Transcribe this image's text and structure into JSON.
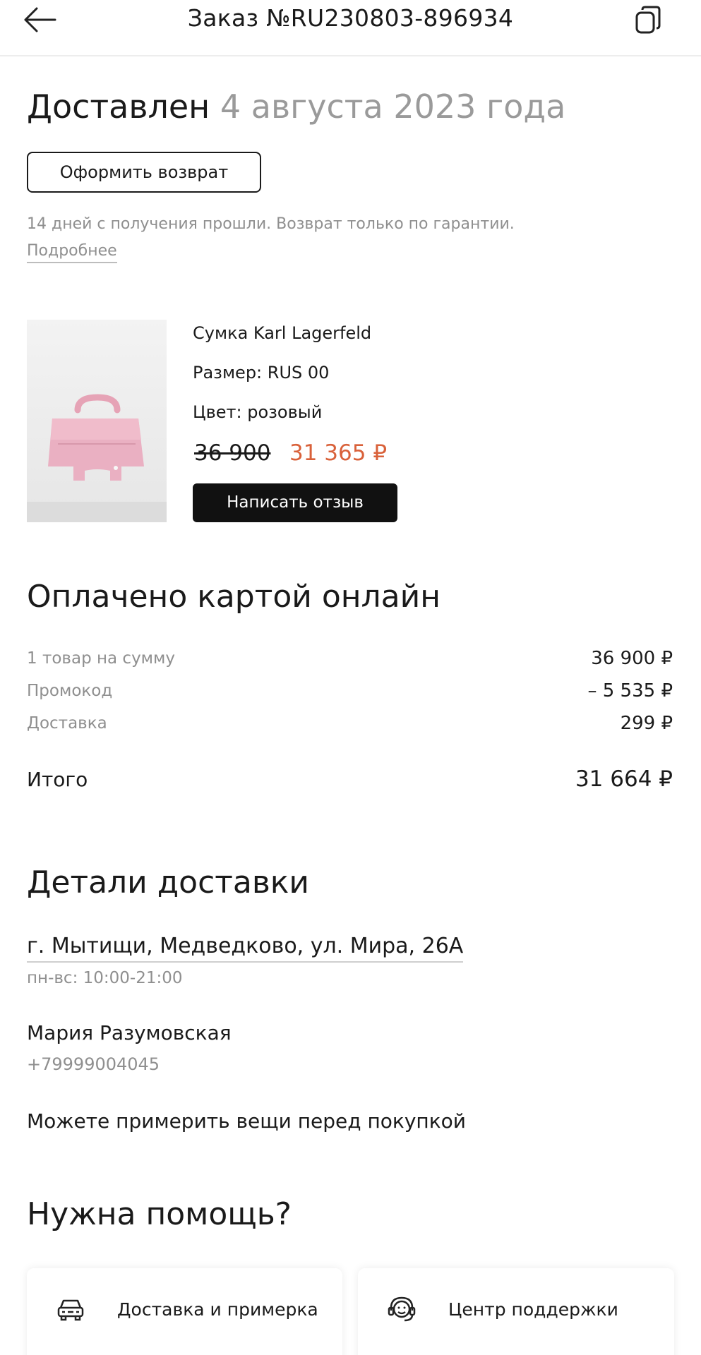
{
  "header": {
    "title": "Заказ №RU230803-896934",
    "back_icon": "arrow-left-icon",
    "copy_icon": "copy-icon"
  },
  "status": {
    "label": "Доставлен",
    "date": "4 августа 2023 года"
  },
  "return_section": {
    "button_label": "Оформить возврат",
    "note": "14 дней с получения прошли. Возврат только по гарантии.",
    "more_link": "Подробнее"
  },
  "product": {
    "image": "pink-handbag-image",
    "name": "Сумка Karl Lagerfeld",
    "size": "Размер: RUS 00",
    "color": "Цвет: розовый",
    "old_price": "36 900",
    "new_price": "31 365 ₽",
    "review_button": "Написать отзыв"
  },
  "payment": {
    "title": "Оплачено картой онлайн",
    "rows": [
      {
        "label": "1 товар на сумму",
        "value": "36 900 ₽"
      },
      {
        "label": "Промокод",
        "value": "– 5 535 ₽"
      },
      {
        "label": "Доставка",
        "value": "299 ₽"
      }
    ],
    "total_label": "Итого",
    "total_value": "31 664 ₽"
  },
  "delivery": {
    "title": "Детали доставки",
    "address": "г. Мытищи, Медведково, ул. Мира, 26А",
    "hours": "пн-вс: 10:00-21:00",
    "recipient_name": "Мария Разумовская",
    "phone": "+79999004045",
    "try_on_note": "Можете примерить вещи перед покупкой"
  },
  "help": {
    "title": "Нужна помощь?",
    "cards": [
      {
        "label": "Доставка и примерка",
        "icon": "delivery-car-icon"
      },
      {
        "label": "Центр поддержки",
        "icon": "support-headset-icon"
      }
    ]
  },
  "colors": {
    "accent_price": "#d9613a",
    "muted_text": "#8f8f8f",
    "dark_button": "#111111"
  }
}
